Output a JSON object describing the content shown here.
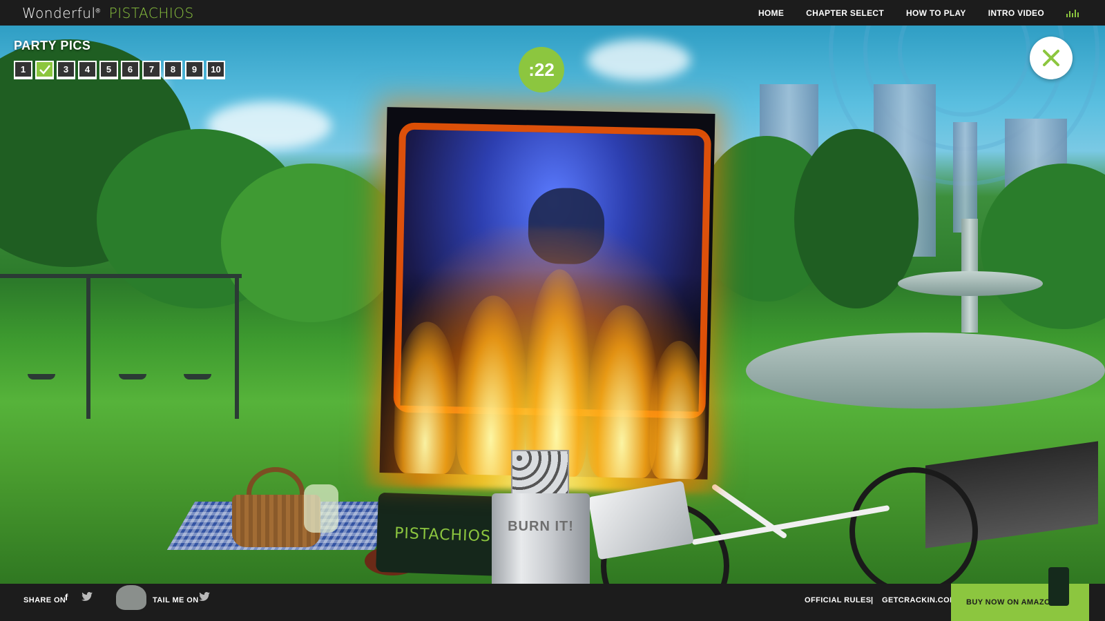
{
  "header": {
    "logo_word": "Wonderful",
    "logo_brand": "PISTACHIOS",
    "nav": [
      "HOME",
      "CHAPTER SELECT",
      "HOW TO PLAY",
      "INTRO VIDEO"
    ],
    "sound_icon": "equalizer-icon"
  },
  "hud": {
    "title": "PARTY PICS",
    "levels": [
      "1",
      "",
      "3",
      "4",
      "5",
      "6",
      "7",
      "8",
      "9",
      "10"
    ],
    "completed_level": 2,
    "timer": ":22",
    "close_icon": "close-icon"
  },
  "scene": {
    "lighter_label": "BURN IT!",
    "bag_label": "PISTACHIOS"
  },
  "footer": {
    "share_label": "SHARE ON",
    "tail_label": "TAIL ME ON",
    "rules": "OFFICIAL RULES",
    "separator": "|",
    "site": "GETCRACKIN.COM",
    "buy": "BUY NOW ON AMAZON"
  },
  "colors": {
    "accent": "#8cc63f",
    "bar": "#1c1c1c",
    "close_x": "#8cc63f"
  }
}
